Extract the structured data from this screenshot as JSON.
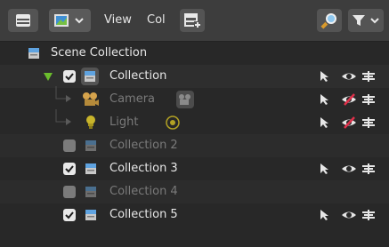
{
  "header": {
    "view_label": "View",
    "col_label": "Col"
  },
  "tree": {
    "scene_collection": "Scene Collection",
    "collection": "Collection",
    "camera": "Camera",
    "light": "Light",
    "collection2": "Collection 2",
    "collection3": "Collection 3",
    "collection4": "Collection 4",
    "collection5": "Collection 5"
  },
  "icons": {
    "editor_type": "outliner-editor-icon",
    "display_mode": "image-display-mode-icon",
    "new_collection": "new-collection-icon",
    "search": "search-icon",
    "filter": "funnel-filter-icon",
    "collection": "collection-icon",
    "camera": "camera-icon",
    "light": "light-bulb-icon",
    "select": "cursor-arrow-icon",
    "visibility": "eye-icon",
    "render": "camera-render-icon"
  },
  "colors": {
    "accent_collection": "#5fa3e0",
    "light_yellow": "#c9b52b",
    "camera_orange": "#d6a34c",
    "expand_green": "#6bbd2d",
    "hidden_red": "#e0304a"
  },
  "state": {
    "collection_checked": true,
    "collection2_checked": false,
    "collection3_checked": true,
    "collection4_checked": false,
    "collection5_checked": true,
    "camera_hidden": true,
    "light_hidden": true
  }
}
